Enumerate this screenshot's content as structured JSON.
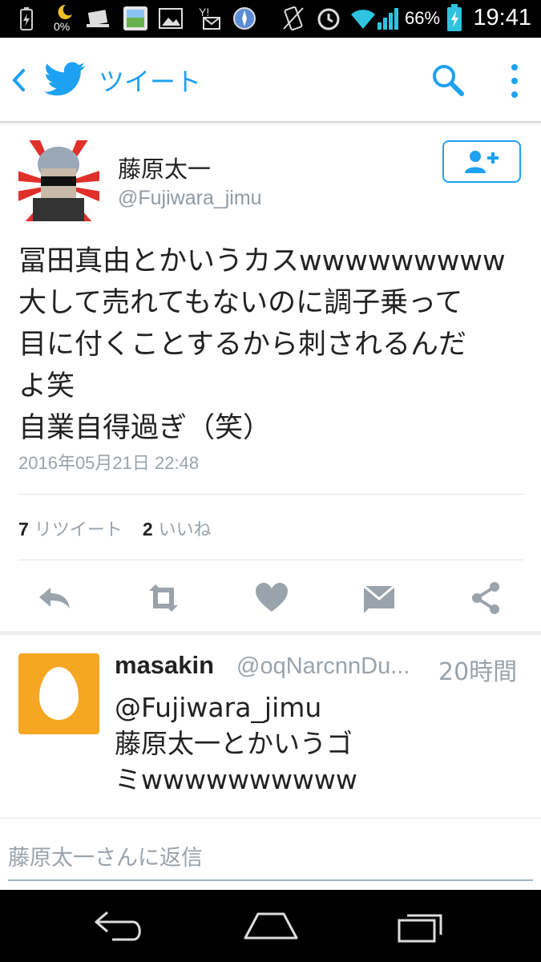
{
  "status_bar": {
    "battery_percent": "0%",
    "battery_percent_right": "66%",
    "time": "19:41"
  },
  "toolbar": {
    "title": "ツイート"
  },
  "tweet": {
    "author_name": "藤原太一",
    "author_handle": "@Fujiwara_jimu",
    "text": "冨田真由とかいうカスwwwwwwwww\n大して売れてもないのに調子乗って\n目に付くことするから刺されるんだ\nよ笑\n自業自得過ぎ（笑）",
    "timestamp": "2016年05月21日 22:48",
    "retweet_count": "7",
    "retweet_label": "リツイート",
    "like_count": "2",
    "like_label": "いいね"
  },
  "reply": {
    "name": "masakin",
    "handle": "@oqNarcnnDu...",
    "time": "20時間",
    "text": "@Fujiwara_jimu\n藤原太一とかいうゴ\nミwwwwwwwwww"
  },
  "composer": {
    "placeholder": "藤原太一さんに返信"
  },
  "colors": {
    "accent": "#1da1f2",
    "egg_bg": "#f5a623"
  }
}
